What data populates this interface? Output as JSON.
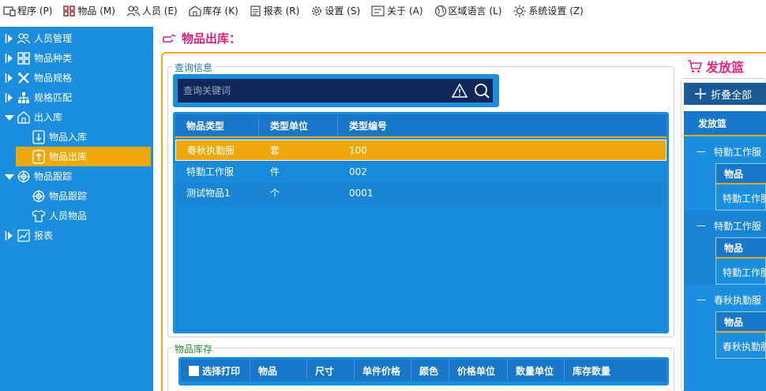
{
  "menu": [
    {
      "label": "程序 (P)",
      "icon": "program-icon"
    },
    {
      "label": "物品 (M)",
      "icon": "grid-icon"
    },
    {
      "label": "人员 (E)",
      "icon": "users-icon"
    },
    {
      "label": "库存 (K)",
      "icon": "warehouse-icon"
    },
    {
      "label": "报表 (R)",
      "icon": "report-icon"
    },
    {
      "label": "设置 (S)",
      "icon": "gear-icon"
    },
    {
      "label": "关于 (A)",
      "icon": "about-icon"
    },
    {
      "label": "区域语言 (L)",
      "icon": "globe-icon"
    },
    {
      "label": "系统设置 (Z)",
      "icon": "sun-icon"
    }
  ],
  "sidebar": {
    "items": [
      {
        "label": "人员管理"
      },
      {
        "label": "物品种类"
      },
      {
        "label": "物品规格"
      },
      {
        "label": "规格匹配"
      },
      {
        "label": "出入库"
      },
      {
        "label": "物品入库"
      },
      {
        "label": "物品出库"
      },
      {
        "label": "物品跟踪"
      },
      {
        "label": "物品跟踪"
      },
      {
        "label": "人员物品"
      },
      {
        "label": "报表"
      }
    ]
  },
  "page": {
    "title": "物品出库："
  },
  "query": {
    "group_label": "查询信息",
    "search_placeholder": "查询关键词",
    "columns": [
      "物品类型",
      "类型单位",
      "类型编号"
    ],
    "rows": [
      [
        "春秋执勤服",
        "套",
        "100"
      ],
      [
        "特勤工作服",
        "件",
        "002"
      ],
      [
        "测试物品1",
        "个",
        "0001"
      ]
    ],
    "selected_row": 0
  },
  "stock": {
    "group_label": "物品库存",
    "columns": [
      "选择打印",
      "物品",
      "尺寸",
      "单件价格",
      "颜色",
      "价格单位",
      "数量单位",
      "库存数量"
    ]
  },
  "basket": {
    "title": "发放篮",
    "collapse_label": "折叠全部",
    "tree_header": "发放篮",
    "nodes": [
      {
        "label": "特勤工作服",
        "sub_header": "物品",
        "sub_value": "特勤工作服"
      },
      {
        "label": "特勤工作服",
        "sub_header": "物品",
        "sub_value": "特勤工作服"
      },
      {
        "label": "春秋执勤服",
        "sub_header": "物品",
        "sub_value": "春秋执勤服"
      }
    ]
  },
  "colors": {
    "sidebar_bg": "#1b8ee0",
    "accent_orange": "#f0a70a",
    "title_pink": "#d9207a",
    "search_bg": "#102759"
  }
}
